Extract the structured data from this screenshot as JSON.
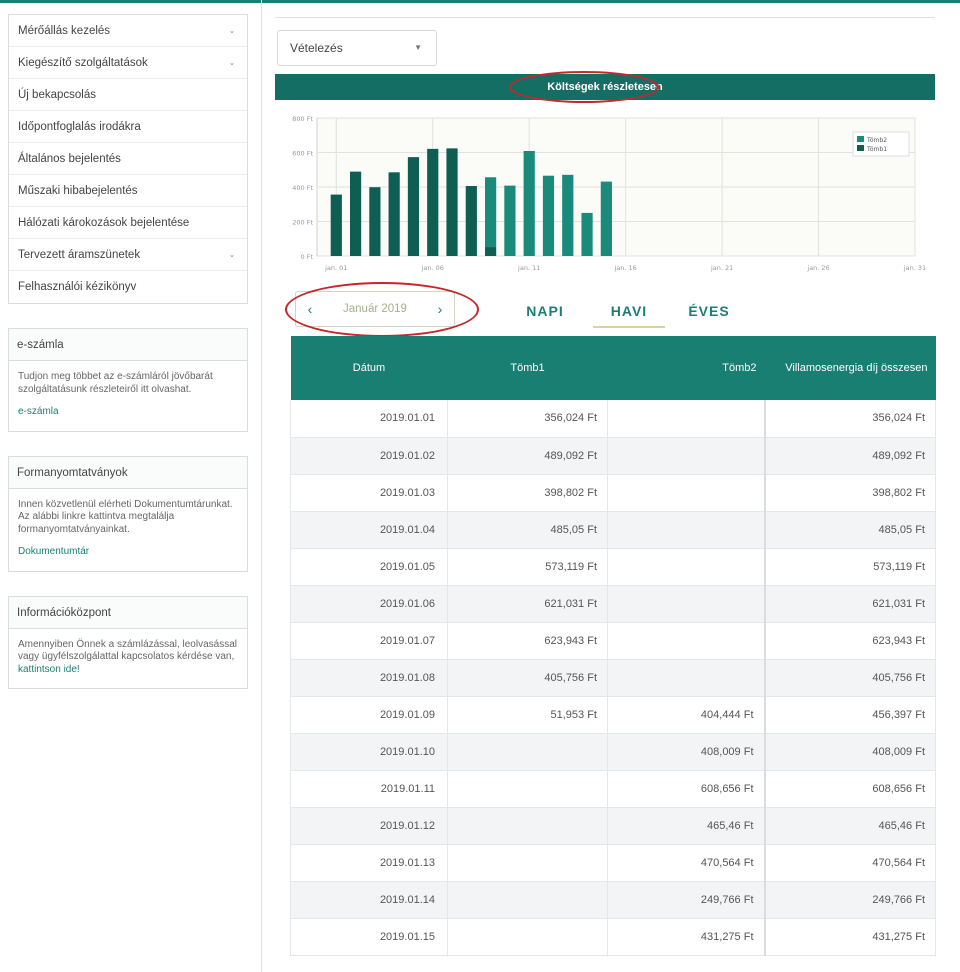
{
  "sidebar": {
    "nav": [
      {
        "label": "Mérőállás kezelés",
        "chevron": true
      },
      {
        "label": "Kiegészítő szolgáltatások",
        "chevron": true
      },
      {
        "label": "Új bekapcsolás",
        "chevron": false
      },
      {
        "label": "Időpontfoglalás irodákra",
        "chevron": false
      },
      {
        "label": "Általános bejelentés",
        "chevron": false
      },
      {
        "label": "Műszaki hibabejelentés",
        "chevron": false
      },
      {
        "label": "Hálózati károkozások bejelentése",
        "chevron": false
      },
      {
        "label": "Tervezett áramszünetek",
        "chevron": true
      },
      {
        "label": "Felhasználói kézikönyv",
        "chevron": false
      }
    ],
    "eszamla": {
      "title": "e-számla",
      "text": "Tudjon meg többet az e-számláról jövőbarát szolgáltatásunk részleteiről itt olvashat.",
      "link": "e-számla"
    },
    "forms": {
      "title": "Formanyomtatványok",
      "text1": "Innen közvetlenül elérheti Dokumentumtárunkat.",
      "text2": "Az alábbi linkre kattintva megtalálja formanyomtatványainkat.",
      "link": "Dokumentumtár"
    },
    "info": {
      "title": "Információközpont",
      "text": "Amennyiben Önnek a számlázással, leolvasással vagy ügyfélszolgálattal kapcsolatos kérdése van,",
      "link": "kattintson ide!"
    }
  },
  "main": {
    "select_value": "Vételezés",
    "chart_header": "Költségek részletesen",
    "pager_label": "Január 2019",
    "tabs": [
      {
        "label": "NAPI",
        "active": false
      },
      {
        "label": "HAVI",
        "active": true
      },
      {
        "label": "ÉVES",
        "active": false
      }
    ],
    "table": {
      "headers": [
        "Dátum",
        "Tömb1",
        "Tömb2",
        "Villamosenergia díj összesen"
      ],
      "rows": [
        [
          "2019.01.01",
          "356,024 Ft",
          "",
          "356,024 Ft"
        ],
        [
          "2019.01.02",
          "489,092 Ft",
          "",
          "489,092 Ft"
        ],
        [
          "2019.01.03",
          "398,802 Ft",
          "",
          "398,802 Ft"
        ],
        [
          "2019.01.04",
          "485,05 Ft",
          "",
          "485,05 Ft"
        ],
        [
          "2019.01.05",
          "573,119 Ft",
          "",
          "573,119 Ft"
        ],
        [
          "2019.01.06",
          "621,031 Ft",
          "",
          "621,031 Ft"
        ],
        [
          "2019.01.07",
          "623,943 Ft",
          "",
          "623,943 Ft"
        ],
        [
          "2019.01.08",
          "405,756 Ft",
          "",
          "405,756 Ft"
        ],
        [
          "2019.01.09",
          "51,953 Ft",
          "404,444 Ft",
          "456,397 Ft"
        ],
        [
          "2019.01.10",
          "",
          "408,009 Ft",
          "408,009 Ft"
        ],
        [
          "2019.01.11",
          "",
          "608,656 Ft",
          "608,656 Ft"
        ],
        [
          "2019.01.12",
          "",
          "465,46 Ft",
          "465,46 Ft"
        ],
        [
          "2019.01.13",
          "",
          "470,564 Ft",
          "470,564 Ft"
        ],
        [
          "2019.01.14",
          "",
          "249,766 Ft",
          "249,766 Ft"
        ],
        [
          "2019.01.15",
          "",
          "431,275 Ft",
          "431,275 Ft"
        ]
      ]
    }
  },
  "colors": {
    "accent": "#1a7f73",
    "header_dark": "#146e63",
    "tomb1": "#0f5e54",
    "tomb2": "#1a8a7b",
    "highlight_oval": "#c4282b"
  },
  "chart_data": {
    "type": "bar",
    "stacked": true,
    "x": [
      "2019-01-01",
      "2019-01-02",
      "2019-01-03",
      "2019-01-04",
      "2019-01-05",
      "2019-01-06",
      "2019-01-07",
      "2019-01-08",
      "2019-01-09",
      "2019-01-10",
      "2019-01-11",
      "2019-01-12",
      "2019-01-13",
      "2019-01-14",
      "2019-01-15"
    ],
    "series": [
      {
        "name": "Tömb1",
        "values": [
          356.024,
          489.092,
          398.802,
          485.05,
          573.119,
          621.031,
          623.943,
          405.756,
          51.953,
          0,
          0,
          0,
          0,
          0,
          0
        ]
      },
      {
        "name": "Tömb2",
        "values": [
          0,
          0,
          0,
          0,
          0,
          0,
          0,
          0,
          404.444,
          408.009,
          608.656,
          465.46,
          470.564,
          249.766,
          431.275
        ]
      }
    ],
    "x_range": [
      "2018-12-31",
      "2019-01-31"
    ],
    "x_ticks": [
      "jan. 01",
      "jan. 06",
      "jan. 11",
      "jan. 16",
      "jan. 21",
      "jan. 26",
      "jan. 31"
    ],
    "y_ticks": [
      "0 Ft",
      "200 Ft",
      "400 Ft",
      "600 Ft",
      "800 Ft"
    ],
    "ylim": [
      0,
      800
    ],
    "grid": true,
    "legend": "top-right"
  }
}
